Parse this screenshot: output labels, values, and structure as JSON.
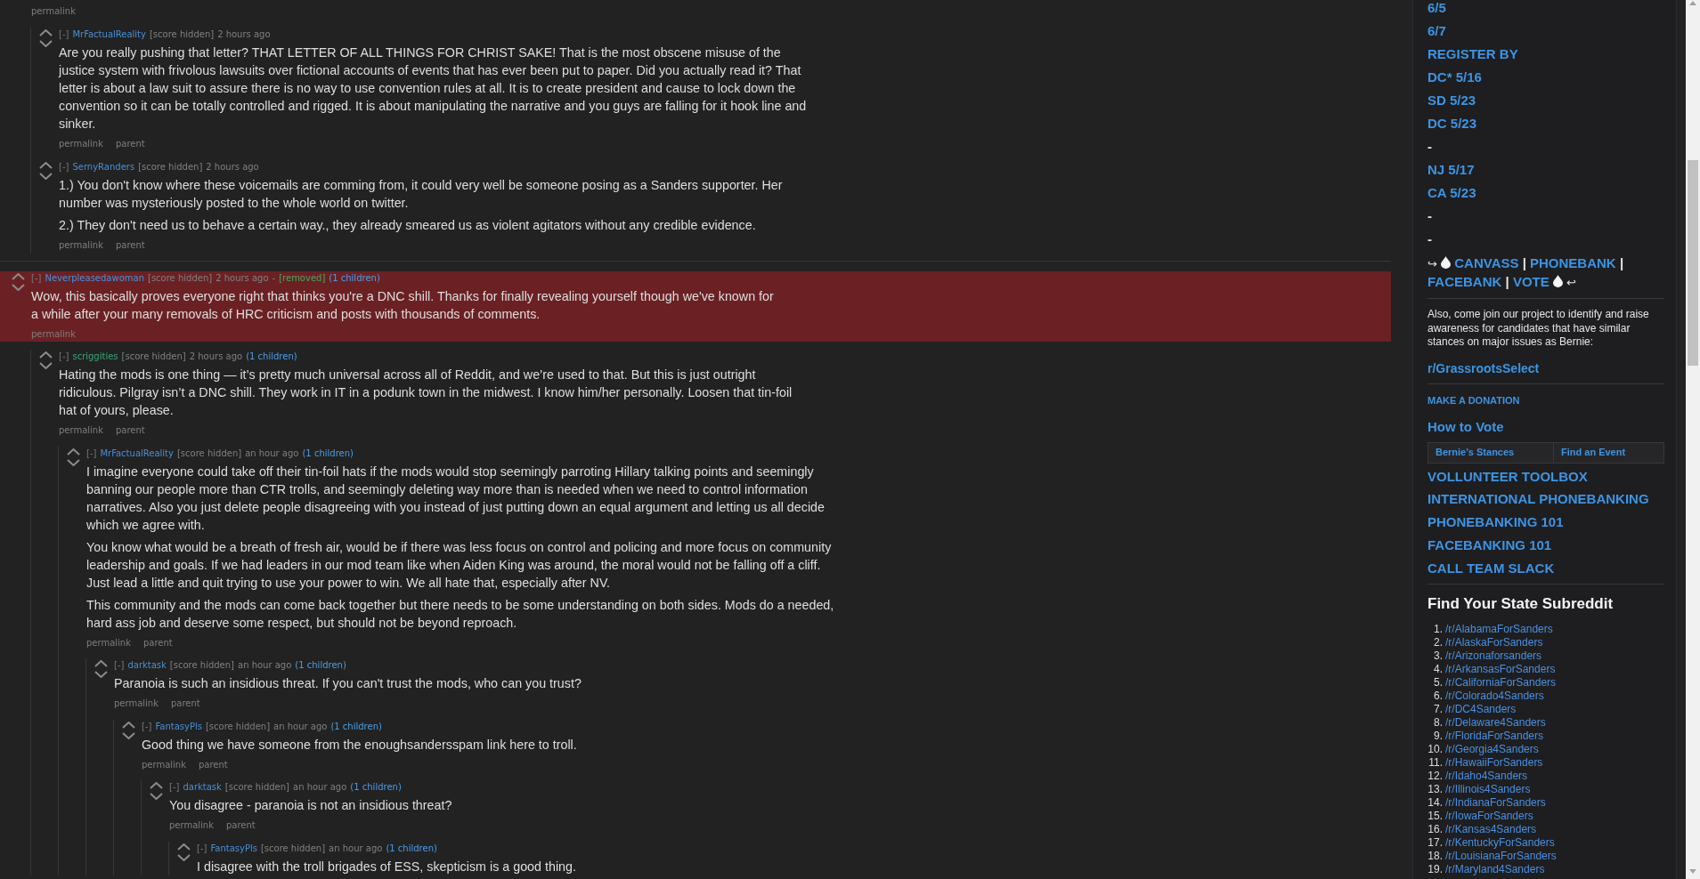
{
  "threads": [
    {
      "links": [
        "permalink"
      ],
      "children": [
        {
          "toggle": "[-]",
          "author": {
            "name": "MrFactualReality",
            "color": "#4a8fd8"
          },
          "score": "[score hidden]",
          "time": "2 hours ago",
          "highlighted": false,
          "body": [
            "Are you really pushing that letter? THAT LETTER OF ALL THINGS FOR CHRIST SAKE! That is the most obscene misuse of the justice system with frivolous lawsuits over fictional accounts of events that has ever been put to paper. Did you actually read it? That letter is about a law suit to assure there is no way to use convention rules at all. It is to create president and cause to lock down the convention so it can be totally controlled and rigged. It is about manipulating the narrative and you guys are falling for it hook line and sinker."
          ],
          "links": [
            "permalink",
            "parent"
          ]
        },
        {
          "toggle": "[-]",
          "author": {
            "name": "SernyRanders",
            "color": "#4a8fd8"
          },
          "score": "[score hidden]",
          "time": "2 hours ago",
          "highlighted": false,
          "body": [
            "1.) You don't know where these voicemails are comming from, it could very well be someone posing as a Sanders supporter. Her number was mysteriously posted to the whole world on twitter.",
            "2.) They don't need us to behave a certain way., they already smeared us as violent agitators without any credible evidence."
          ],
          "links": [
            "permalink",
            "parent"
          ]
        }
      ]
    },
    {
      "toggle": "[-]",
      "author": {
        "name": "Neverpleasedawoman",
        "color": "#4a8fd8"
      },
      "score": "[score hidden]",
      "time": "2 hours ago",
      "removed": {
        "dash": "-",
        "label": "[removed]"
      },
      "children_count": "(1 children)",
      "highlighted": true,
      "body": [
        "Wow, this basically proves everyone right that thinks you're a DNC shill. Thanks for finally revealing yourself though we've known for a while after your many removals of HRC criticism and posts with thousands of comments."
      ],
      "links": [
        "permalink"
      ],
      "children": [
        {
          "toggle": "[-]",
          "author": {
            "name": "scriggities",
            "color": "#38a676"
          },
          "score": "[score hidden]",
          "time": "2 hours ago",
          "children_count": "(1 children)",
          "highlighted": false,
          "body": [
            "Hating the mods is one thing — it’s pretty much universal across all of Reddit, and we’re used to that. But this is just outright ridiculous. Pilgray isn’t a DNC shill. They work in IT in a podunk town in the midwest. I know him/her personally. Loosen that tin-foil hat of yours, please."
          ],
          "links": [
            "permalink",
            "parent"
          ],
          "children": [
            {
              "toggle": "[-]",
              "author": {
                "name": "MrFactualReality",
                "color": "#4a8fd8"
              },
              "score": "[score hidden]",
              "time": "an hour ago",
              "children_count": "(1 children)",
              "highlighted": false,
              "body": [
                "I imagine everyone could take off their tin-foil hats if the mods would stop seemingly parroting Hillary talking points and seemingly banning our people more than CTR trolls, and seemingly deleting way more than is needed when we need to control information narratives. Also you just delete people disagreeing with you instead of just putting down an equal argument and letting us all decide which we agree with.",
                "You know what would be a breath of fresh air, would be if there was less focus on control and policing and more focus on community leadership and goals. If we had leaders in our mod team like when Aiden King was around, the moral would not be falling off a cliff. Just lead a little and quit trying to use your power to win. We all hate that, especially after NV.",
                "This community and the mods can come back together but there needs to be some understanding on both sides. Mods do a needed, hard ass job and deserve some respect, but should not be beyond reproach."
              ],
              "links": [
                "permalink",
                "parent"
              ],
              "children": [
                {
                  "toggle": "[-]",
                  "author": {
                    "name": "darktask",
                    "color": "#4a8fd8"
                  },
                  "score": "[score hidden]",
                  "time": "an hour ago",
                  "children_count": "(1 children)",
                  "highlighted": false,
                  "body": [
                    "Paranoia is such an insidious threat. If you can't trust the mods, who can you trust?"
                  ],
                  "links": [
                    "permalink",
                    "parent"
                  ],
                  "children": [
                    {
                      "toggle": "[-]",
                      "author": {
                        "name": "FantasyPls",
                        "color": "#4a8fd8"
                      },
                      "score": "[score hidden]",
                      "time": "an hour ago",
                      "children_count": "(1 children)",
                      "highlighted": false,
                      "body": [
                        "Good thing we have someone from the enoughsandersspam link here to troll."
                      ],
                      "links": [
                        "permalink",
                        "parent"
                      ],
                      "children": [
                        {
                          "toggle": "[-]",
                          "author": {
                            "name": "darktask",
                            "color": "#4a8fd8"
                          },
                          "score": "[score hidden]",
                          "time": "an hour ago",
                          "children_count": "(1 children)",
                          "highlighted": false,
                          "body": [
                            "You disagree - paranoia is not an insidious threat?"
                          ],
                          "links": [
                            "permalink",
                            "parent"
                          ],
                          "children": [
                            {
                              "toggle": "[-]",
                              "author": {
                                "name": "FantasyPls",
                                "color": "#4a8fd8"
                              },
                              "score": "[score hidden]",
                              "time": "an hour ago",
                              "children_count": "(1 children)",
                              "highlighted": false,
                              "body": [
                                "I disagree with the troll brigades of ESS, skepticism is a good thing."
                              ]
                            }
                          ]
                        }
                      ]
                    }
                  ]
                }
              ]
            }
          ]
        }
      ]
    }
  ],
  "sidebar": {
    "dates": [
      {
        "kind": "link",
        "text": "6/5"
      },
      {
        "kind": "link",
        "text": "6/7"
      },
      {
        "kind": "link",
        "text": "REGISTER BY"
      },
      {
        "kind": "link",
        "text": "DC* 5/16"
      },
      {
        "kind": "link",
        "text": "SD 5/23"
      },
      {
        "kind": "link",
        "text": "DC 5/23"
      },
      {
        "kind": "dash",
        "text": "-"
      },
      {
        "kind": "link",
        "text": "NJ 5/17"
      },
      {
        "kind": "link",
        "text": "CA 5/23"
      },
      {
        "kind": "dash",
        "text": "-"
      },
      {
        "kind": "dash",
        "text": "-"
      }
    ],
    "actions": [
      {
        "kind": "arrow",
        "text": "↪"
      },
      {
        "kind": "droplet"
      },
      {
        "kind": "link",
        "text": "CANVASS"
      },
      {
        "kind": "separator",
        "text": "|"
      },
      {
        "kind": "link",
        "text": "PHONEBANK"
      },
      {
        "kind": "separator",
        "text": "|"
      },
      {
        "kind": "link",
        "text": "FACEBANK"
      },
      {
        "kind": "separator",
        "text": "|"
      },
      {
        "kind": "link",
        "text": "VOTE"
      },
      {
        "kind": "droplet"
      },
      {
        "kind": "arrow",
        "text": "↩"
      }
    ],
    "promo": "Also, come join our project to identify and raise awareness for candidates that have similar stances on major issues as Bernie:",
    "promo_link": "r/GrassrootsSelect",
    "donation_link": "MAKE A DONATION",
    "how_to_vote": "How to Vote",
    "vote_table": [
      "Bernie's Stances",
      "Find an Event"
    ],
    "resources": [
      "VOLLUNTEER TOOLBOX",
      "INTERNATIONAL PHONEBANKING",
      "PHONEBANKING 101",
      "FACEBANKING 101",
      "CALL TEAM SLACK"
    ],
    "state_heading": "Find Your State Subreddit",
    "states": [
      {
        "number": "1.",
        "name": "/r/AlabamaForSanders"
      },
      {
        "number": "2.",
        "name": "/r/AlaskaForSanders"
      },
      {
        "number": "3.",
        "name": "/r/Arizonaforsanders"
      },
      {
        "number": "4.",
        "name": "/r/ArkansasForSanders"
      },
      {
        "number": "5.",
        "name": "/r/CaliforniaForSanders"
      },
      {
        "number": "6.",
        "name": "/r/Colorado4Sanders"
      },
      {
        "number": "7.",
        "name": "/r/DC4Sanders"
      },
      {
        "number": "8.",
        "name": "/r/Delaware4Sanders"
      },
      {
        "number": "9.",
        "name": "/r/FloridaForSanders"
      },
      {
        "number": "10.",
        "name": "/r/Georgia4Sanders"
      },
      {
        "number": "11.",
        "name": "/r/HawaiiForSanders"
      },
      {
        "number": "12.",
        "name": "/r/Idaho4Sanders"
      },
      {
        "number": "13.",
        "name": "/r/Illinois4Sanders"
      },
      {
        "number": "14.",
        "name": "/r/IndianaForSanders"
      },
      {
        "number": "15.",
        "name": "/r/IowaForSanders"
      },
      {
        "number": "16.",
        "name": "/r/Kansas4Sanders"
      },
      {
        "number": "17.",
        "name": "/r/KentuckyForSanders"
      },
      {
        "number": "18.",
        "name": "/r/LouisianaForSanders"
      },
      {
        "number": "19.",
        "name": "/r/Maryland4Sanders"
      }
    ]
  }
}
